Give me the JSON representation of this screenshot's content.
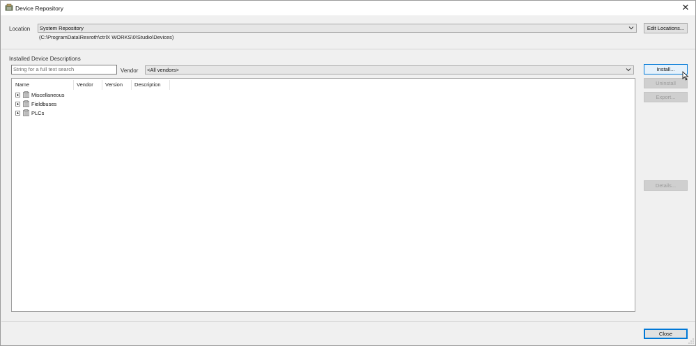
{
  "window": {
    "title": "Device Repository",
    "close_glyph": "✕"
  },
  "location": {
    "label": "Location",
    "selected": "System Repository",
    "path": "(C:\\ProgramData\\Rexroth\\ctrlX WORKS\\0\\Studio\\Devices)",
    "edit_button": "Edit Locations..."
  },
  "installed": {
    "section_label": "Installed Device Descriptions",
    "search_placeholder": "String for a full text search",
    "vendor_label": "Vendor",
    "vendor_selected": "<All vendors>"
  },
  "table": {
    "columns": [
      "Name",
      "Vendor",
      "Version",
      "Description"
    ],
    "rows": [
      {
        "label": "Miscellaneous",
        "icon": "device-folder-icon"
      },
      {
        "label": "Fieldbuses",
        "icon": "device-folder-icon"
      },
      {
        "label": "PLCs",
        "icon": "device-folder-icon"
      }
    ]
  },
  "buttons": {
    "install": "Install...",
    "uninstall": "Uninstall",
    "export": "Export...",
    "details": "Details...",
    "close": "Close"
  },
  "colors": {
    "accent": "#0078d7",
    "window_bg": "#f0f0f0",
    "disabled_text": "#9b9b9b"
  }
}
